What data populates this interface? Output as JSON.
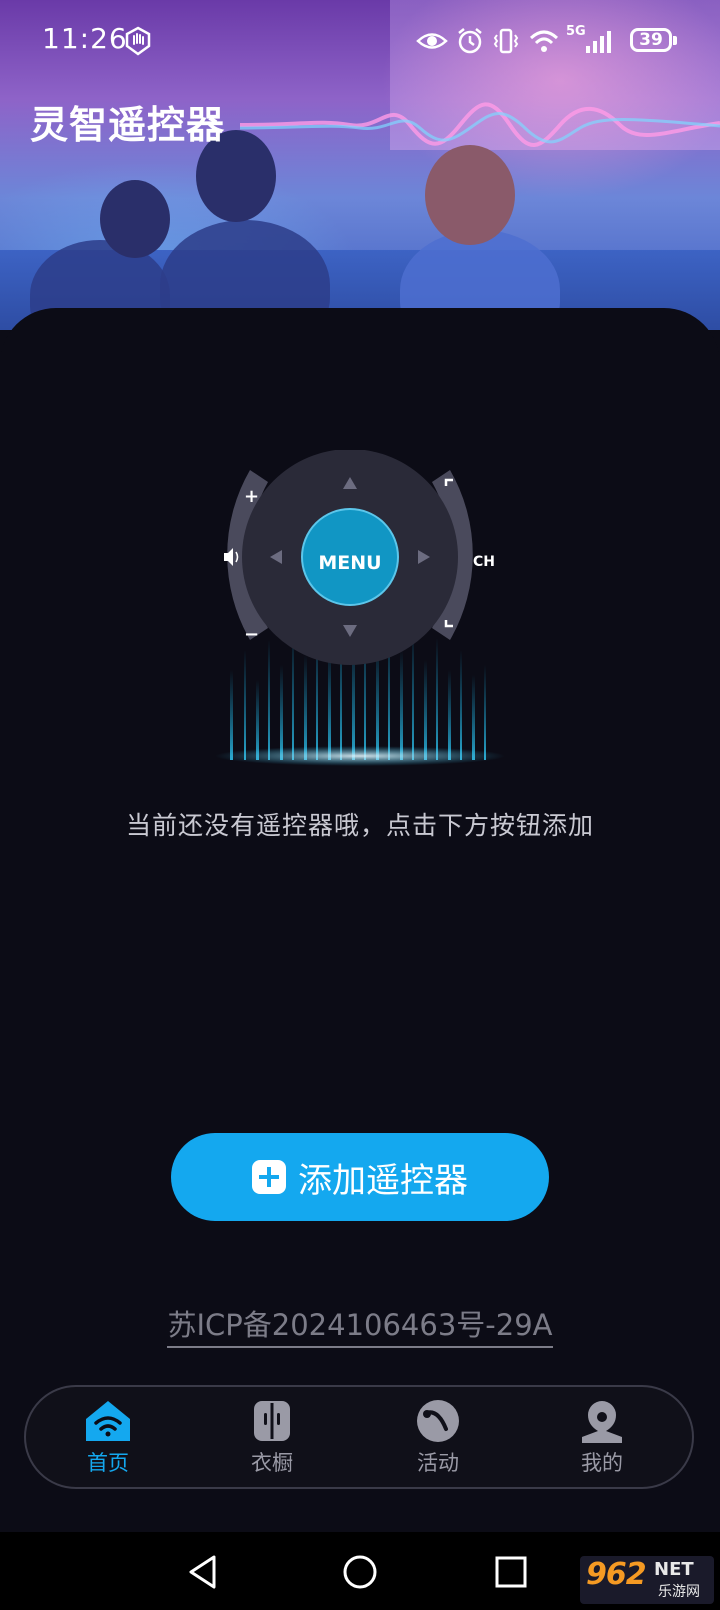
{
  "status_bar": {
    "time": "11:26",
    "network": "5G",
    "battery": "39"
  },
  "app": {
    "title": "灵智遥控器"
  },
  "remote_graphic": {
    "menu_label": "MENU",
    "plus_label": "+",
    "minus_label": "−",
    "channel_label": "CH"
  },
  "empty_state": {
    "message": "当前还没有遥控器哦，点击下方按钮添加"
  },
  "add_button": {
    "label": "添加遥控器"
  },
  "footer": {
    "icp": "苏ICP备2024106463号-29A"
  },
  "tabs": [
    {
      "label": "首页",
      "icon": "home-remote-icon",
      "active": true
    },
    {
      "label": "衣橱",
      "icon": "wardrobe-icon",
      "active": false
    },
    {
      "label": "活动",
      "icon": "activity-icon",
      "active": false
    },
    {
      "label": "我的",
      "icon": "profile-icon",
      "active": false
    }
  ],
  "watermark": {
    "number": "962",
    "brand": "NET",
    "subtitle": "乐游网"
  },
  "colors": {
    "accent": "#14a8ef",
    "background": "#0c0c16",
    "tab_inactive": "#9a9aa6",
    "menu_button": "#1196c4"
  }
}
